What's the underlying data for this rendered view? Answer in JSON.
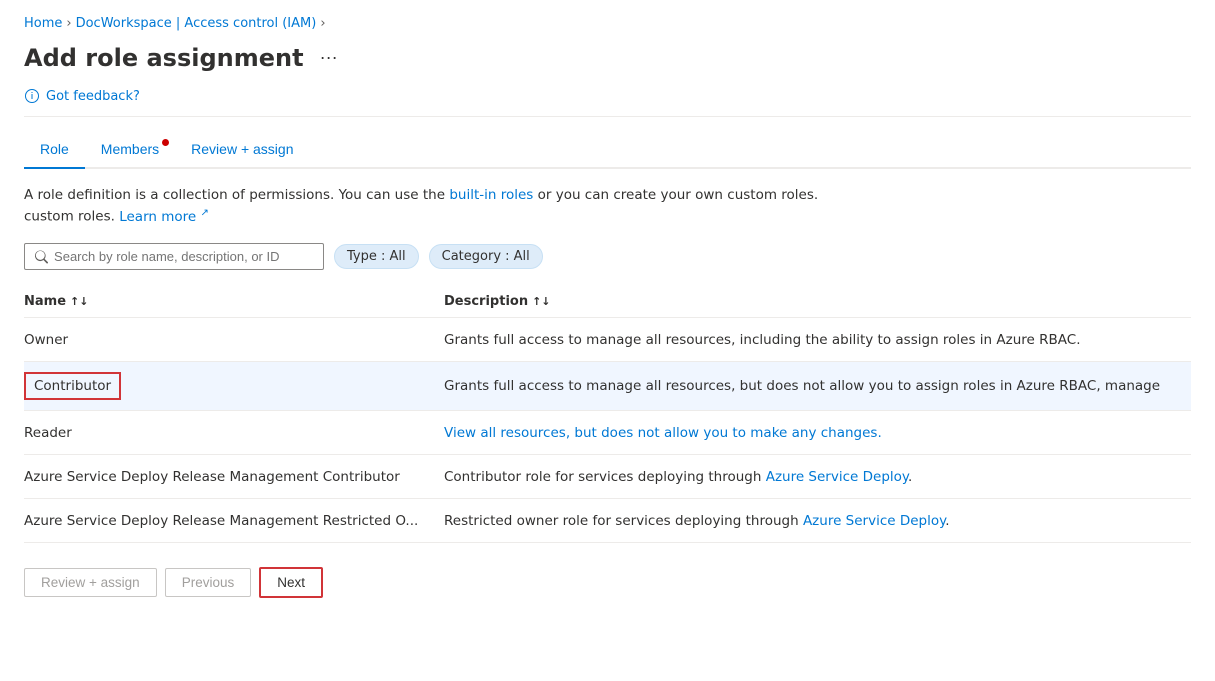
{
  "breadcrumb": {
    "home": "Home",
    "workspace": "DocWorkspace | Access control (IAM)",
    "page": "Add role assignment"
  },
  "page": {
    "title": "Add role assignment",
    "more_label": "···"
  },
  "feedback": {
    "label": "Got feedback?"
  },
  "tabs": [
    {
      "id": "role",
      "label": "Role",
      "active": true,
      "has_dot": false
    },
    {
      "id": "members",
      "label": "Members",
      "active": false,
      "has_dot": true
    },
    {
      "id": "review",
      "label": "Review + assign",
      "active": false,
      "has_dot": false
    }
  ],
  "description": {
    "text1": "A role definition is a collection of permissions. You can use the ",
    "link1": "built-in roles",
    "text2": " or you can create your own custom roles. ",
    "learn_more": "Learn more",
    "ext": "↗"
  },
  "search": {
    "placeholder": "Search by role name, description, or ID"
  },
  "filters": {
    "type": "Type : All",
    "category": "Category : All"
  },
  "table": {
    "col_name": "Name",
    "col_desc": "Description",
    "rows": [
      {
        "name": "Owner",
        "description": "Grants full access to manage all resources, including the ability to assign roles in Azure RBAC.",
        "selected": false,
        "has_link": false
      },
      {
        "name": "Contributor",
        "description": "Grants full access to manage all resources, but does not allow you to assign roles in Azure RBAC, manage",
        "selected": true,
        "has_link": false
      },
      {
        "name": "Reader",
        "description": "View all resources, but does not allow you to make any changes.",
        "selected": false,
        "has_link": false
      },
      {
        "name": "Azure Service Deploy Release Management Contributor",
        "description": "Contributor role for services deploying through Azure Service Deploy.",
        "selected": false,
        "has_link": true,
        "link_text": "Azure Service Deploy"
      },
      {
        "name": "Azure Service Deploy Release Management Restricted O...",
        "description": "Restricted owner role for services deploying through Azure Service Deploy.",
        "selected": false,
        "has_link": true,
        "link_text": "Azure Service Deploy"
      }
    ]
  },
  "footer": {
    "review_assign": "Review + assign",
    "previous": "Previous",
    "next": "Next"
  }
}
